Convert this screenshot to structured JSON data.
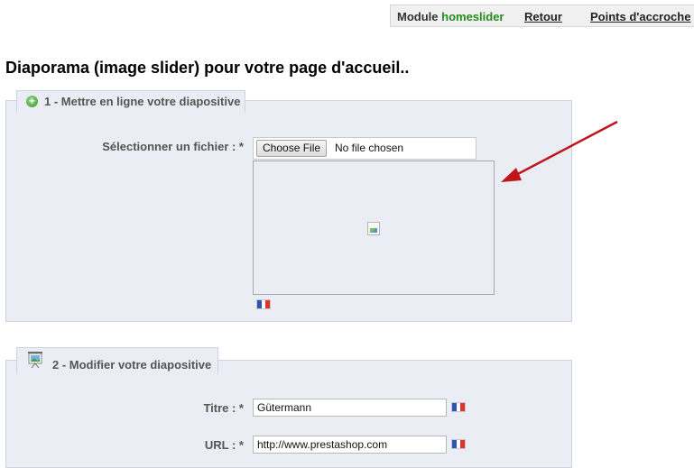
{
  "toolbar": {
    "module_prefix": "Module",
    "module_name": "homeslider",
    "back_label": "Retour",
    "hooks_label": "Points d'accroche"
  },
  "page": {
    "title": "Diaporama (image slider) pour votre page d'accueil.."
  },
  "upload_section": {
    "legend": "1 - Mettre en ligne votre diapositive",
    "file_label": "Sélectionner un fichier : *",
    "file_button": "Choose File",
    "file_status": "No file chosen",
    "language_flag": "france-flag-icon"
  },
  "edit_section": {
    "legend": "2 - Modifier votre diapositive",
    "title_label": "Titre : *",
    "title_value": "Gütermann",
    "url_label": "URL : *",
    "url_value": "http://www.prestashop.com"
  },
  "colors": {
    "accent_green": "#268c1e",
    "panel_bg": "#ebedf4",
    "annotation_arrow": "#c0141b"
  }
}
